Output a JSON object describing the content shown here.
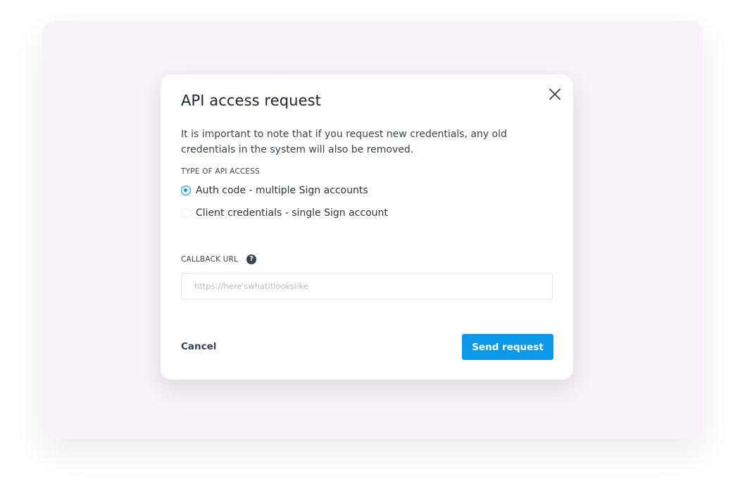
{
  "modal": {
    "title": "API access request",
    "description": "It is important to note that if you request new credentials, any old credentials in the system will also be removed.",
    "access_type_label": "TYPE OF API ACCESS",
    "options": [
      {
        "label": "Auth code - multiple Sign accounts",
        "selected": true
      },
      {
        "label": "Client credentials - single Sign account",
        "selected": false
      }
    ],
    "callback_label": "CALLBACK URL",
    "help_glyph": "?",
    "callback_placeholder": "https://here'swhatitlookslike",
    "callback_value": "",
    "cancel_label": "Cancel",
    "send_label": "Send request"
  },
  "colors": {
    "background": "#f8f1f9",
    "primary": "#0b98e6",
    "radio_accent": "#1a9bd7",
    "text": "#1b2430"
  },
  "icons": {
    "close": "close-icon",
    "help": "help-icon"
  }
}
